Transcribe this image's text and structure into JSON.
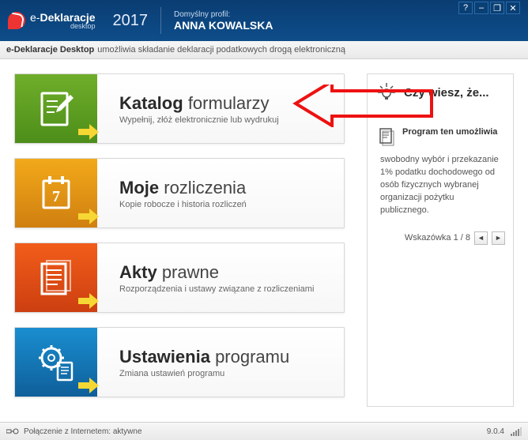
{
  "window": {
    "app_name_prefix": "e-",
    "app_name": "Deklaracje",
    "app_name_sub": "desktop",
    "year": "2017",
    "profile_label": "Domyślny profil:",
    "profile_name": "ANNA KOWALSKA"
  },
  "subheader": {
    "app": "e-Deklaracje Desktop",
    "desc": "umożliwia składanie deklaracji podatkowych drogą elektroniczną"
  },
  "cards": [
    {
      "title_bold": "Katalog",
      "title_light": "formularzy",
      "sub": "Wypełnij, złóż elektronicznie lub wydrukuj",
      "icon": "form-edit",
      "color": "green"
    },
    {
      "title_bold": "Moje",
      "title_light": "rozliczenia",
      "sub": "Kopie robocze i historia rozliczeń",
      "icon": "calendar-7",
      "color": "orange"
    },
    {
      "title_bold": "Akty",
      "title_light": "prawne",
      "sub": "Rozporządzenia i ustawy związane z rozliczeniami",
      "icon": "documents",
      "color": "redorange"
    },
    {
      "title_bold": "Ustawienia",
      "title_light": "programu",
      "sub": "Zmiana ustawień programu",
      "icon": "settings-doc",
      "color": "blue"
    }
  ],
  "tips": {
    "title": "Czy wiesz, że...",
    "heading": "Program ten umożliwia",
    "text": "swobodny wybór i przekazanie 1% podatku dochodowego od osób fizycznych wybranej organizacji pożytku publicznego.",
    "counter": "Wskazówka 1 / 8"
  },
  "status": {
    "connection": "Połączenie z Internetem: aktywne",
    "version": "9.0.4"
  },
  "win_buttons": {
    "help": "?",
    "min": "–",
    "max": "❐",
    "close": "✕"
  }
}
